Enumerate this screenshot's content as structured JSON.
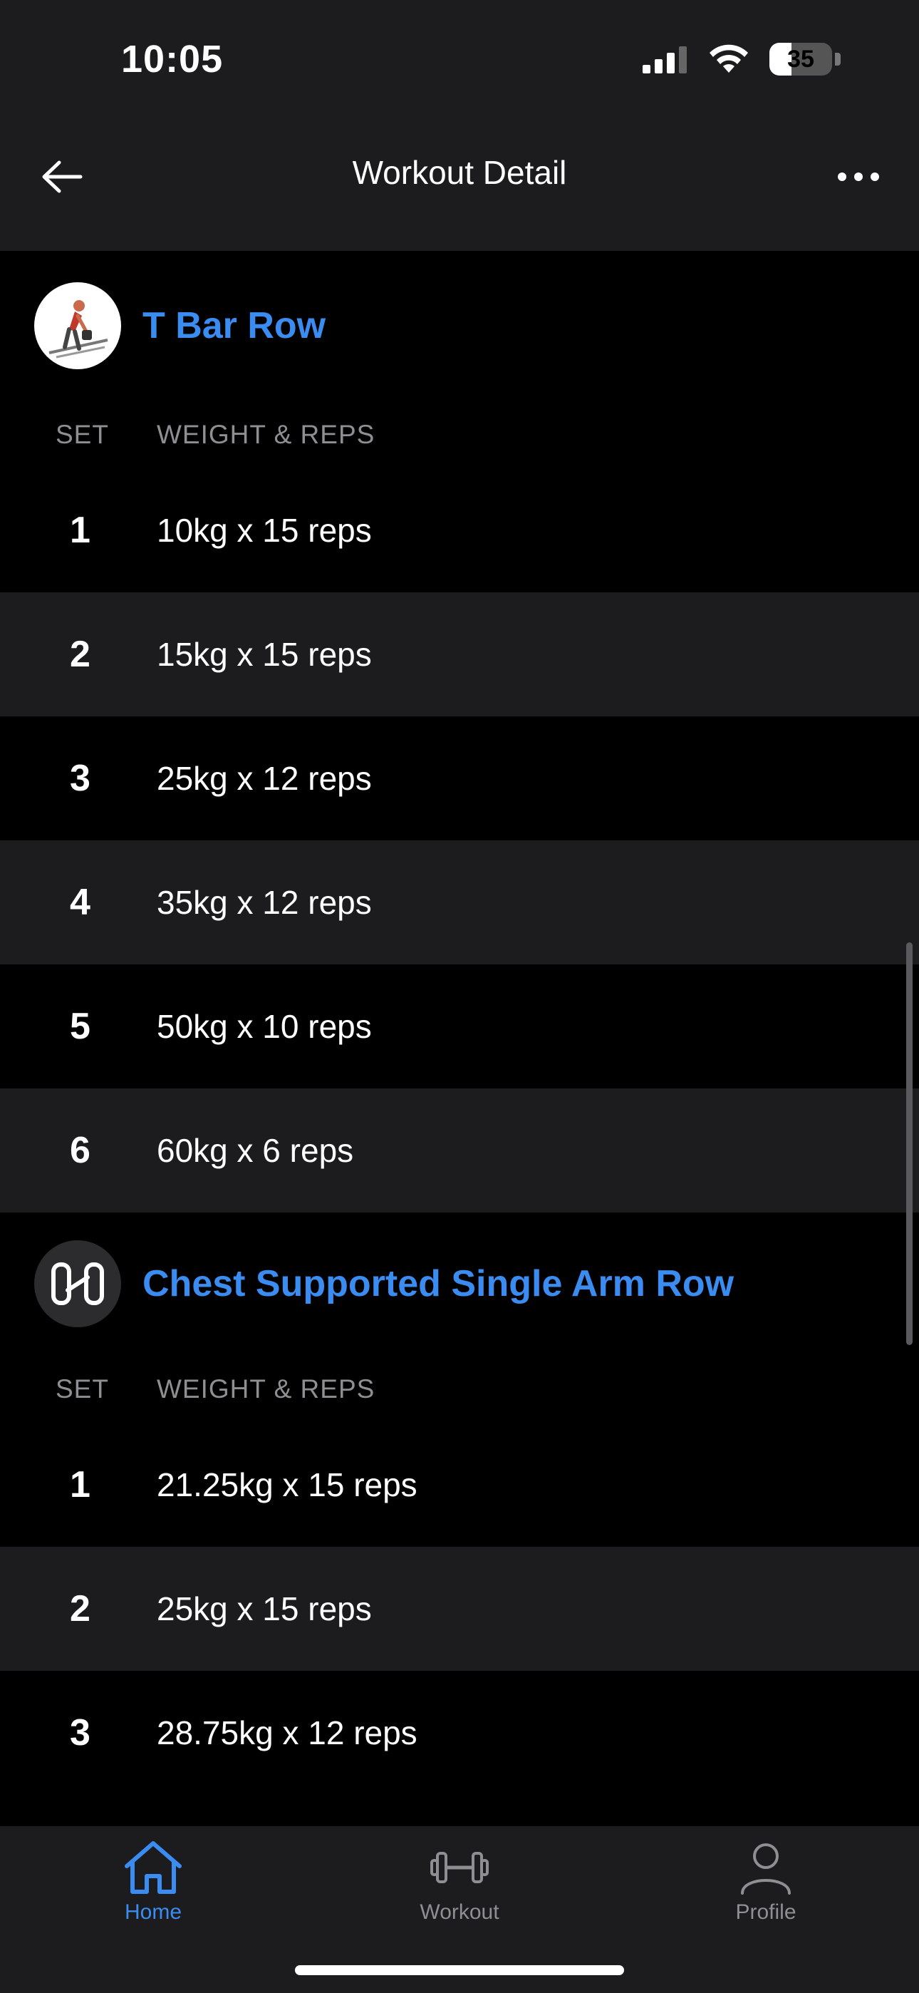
{
  "status_bar": {
    "time": "10:05",
    "battery": "35"
  },
  "nav": {
    "title": "Workout Detail"
  },
  "columns": {
    "set": "SET",
    "weight": "WEIGHT & REPS"
  },
  "exercises": [
    {
      "name": "T Bar Row",
      "sets": [
        {
          "num": "1",
          "value": "10kg x 15 reps"
        },
        {
          "num": "2",
          "value": "15kg x 15 reps"
        },
        {
          "num": "3",
          "value": "25kg x 12 reps"
        },
        {
          "num": "4",
          "value": "35kg x 12 reps"
        },
        {
          "num": "5",
          "value": "50kg x 10 reps"
        },
        {
          "num": "6",
          "value": "60kg x 6 reps"
        }
      ]
    },
    {
      "name": "Chest Supported Single Arm Row",
      "sets": [
        {
          "num": "1",
          "value": "21.25kg x 15 reps"
        },
        {
          "num": "2",
          "value": "25kg x 15 reps"
        },
        {
          "num": "3",
          "value": "28.75kg x 12 reps"
        }
      ]
    }
  ],
  "tabs": [
    {
      "label": "Home",
      "icon": "home-icon",
      "active": true
    },
    {
      "label": "Workout",
      "icon": "dumbbell-icon",
      "active": false
    },
    {
      "label": "Profile",
      "icon": "person-icon",
      "active": false
    }
  ],
  "colors": {
    "accent": "#3a8cf0",
    "background": "#000000",
    "surface": "#1c1c1e",
    "muted": "#8e8e93"
  }
}
